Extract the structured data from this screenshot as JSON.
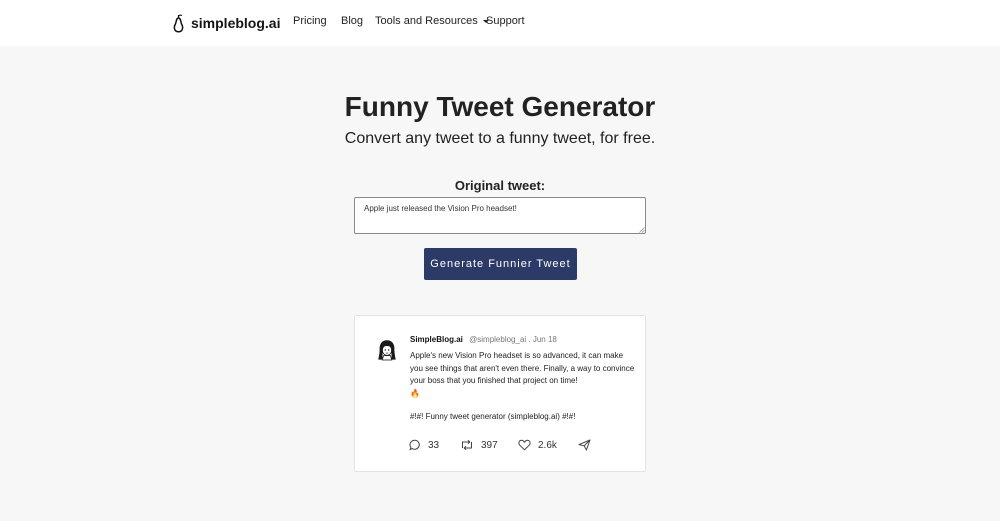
{
  "nav": {
    "brand": "simpleblog.ai",
    "links": {
      "pricing": "Pricing",
      "blog": "Blog",
      "tools": "Tools and Resources",
      "support": "Support"
    }
  },
  "hero": {
    "title": "Funny Tweet Generator",
    "subtitle": "Convert any tweet to a funny tweet, for free."
  },
  "form": {
    "label": "Original tweet:",
    "input_value": "Apple just released the Vision Pro headset!",
    "button_label": "Generate Funnier Tweet"
  },
  "tweet": {
    "author": "SimpleBlog.ai",
    "handle": "@simpleblog_ai . Jun 18",
    "text": "Apple's new Vision Pro headset is so advanced, it can make you see things that aren't even there. Finally, a way to convince your boss that you finished that project on time!",
    "emoji": "🔥",
    "footer": "#!#! Funny tweet generator (simpleblog.ai) #!#!",
    "stats": {
      "replies": "33",
      "retweets": "397",
      "likes": "2.6k"
    }
  },
  "icons": {
    "brand": "pear-logo-icon",
    "reply": "comment-icon",
    "retweet": "retweet-icon",
    "like": "heart-icon",
    "share": "send-icon"
  },
  "colors": {
    "accent": "#2b3a67",
    "background": "#f7f7f7"
  }
}
